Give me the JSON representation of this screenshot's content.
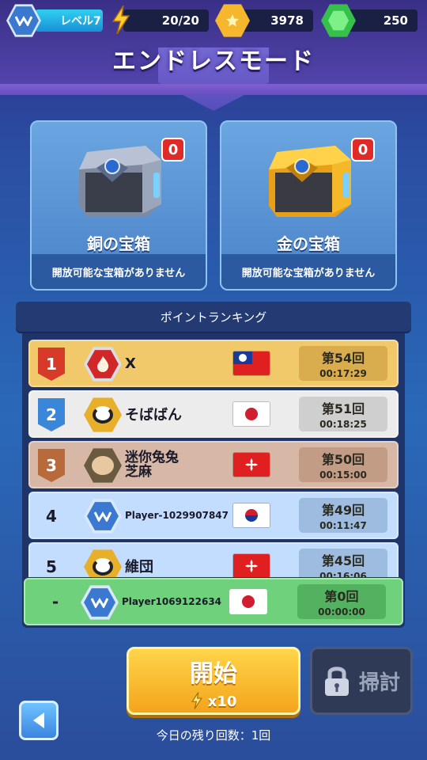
{
  "header": {
    "level_label": "レベル7",
    "stamina": "20/20",
    "gold": "3978",
    "gems": "250",
    "title": "エンドレスモード"
  },
  "chests": [
    {
      "name": "銅の宝箱",
      "count": "0",
      "message": "開放可能な宝箱がありません"
    },
    {
      "name": "金の宝箱",
      "count": "0",
      "message": "開放可能な宝箱がありません"
    }
  ],
  "ranking": {
    "header": "ポイントランキング",
    "rows": [
      {
        "pos": "1",
        "name": "X",
        "round": "第54回",
        "time": "00:17:29"
      },
      {
        "pos": "2",
        "name": "そばばん",
        "round": "第51回",
        "time": "00:18:25"
      },
      {
        "pos": "3",
        "name": "迷你兔兔\n芝麻",
        "round": "第50回",
        "time": "00:15:00"
      },
      {
        "pos": "4",
        "name": "Player-1029907847",
        "round": "第49回",
        "time": "00:11:47"
      },
      {
        "pos": "5",
        "name": "維団",
        "round": "第45回",
        "time": "00:16:06"
      }
    ],
    "self": {
      "pos": "-",
      "name": "Player1069122634",
      "round": "第0回",
      "time": "00:00:00"
    }
  },
  "actions": {
    "start_label": "開始",
    "start_cost": "x10",
    "sweep_label": "掃討",
    "remaining": "今日の残り回数：1回"
  },
  "colors": {
    "gold": "#f3a41c",
    "row1": "#f2c96a",
    "row2": "#e8e8e8",
    "row3": "#d7b8a6",
    "rowblue": "#c2ddff",
    "self": "#6fd17c"
  }
}
